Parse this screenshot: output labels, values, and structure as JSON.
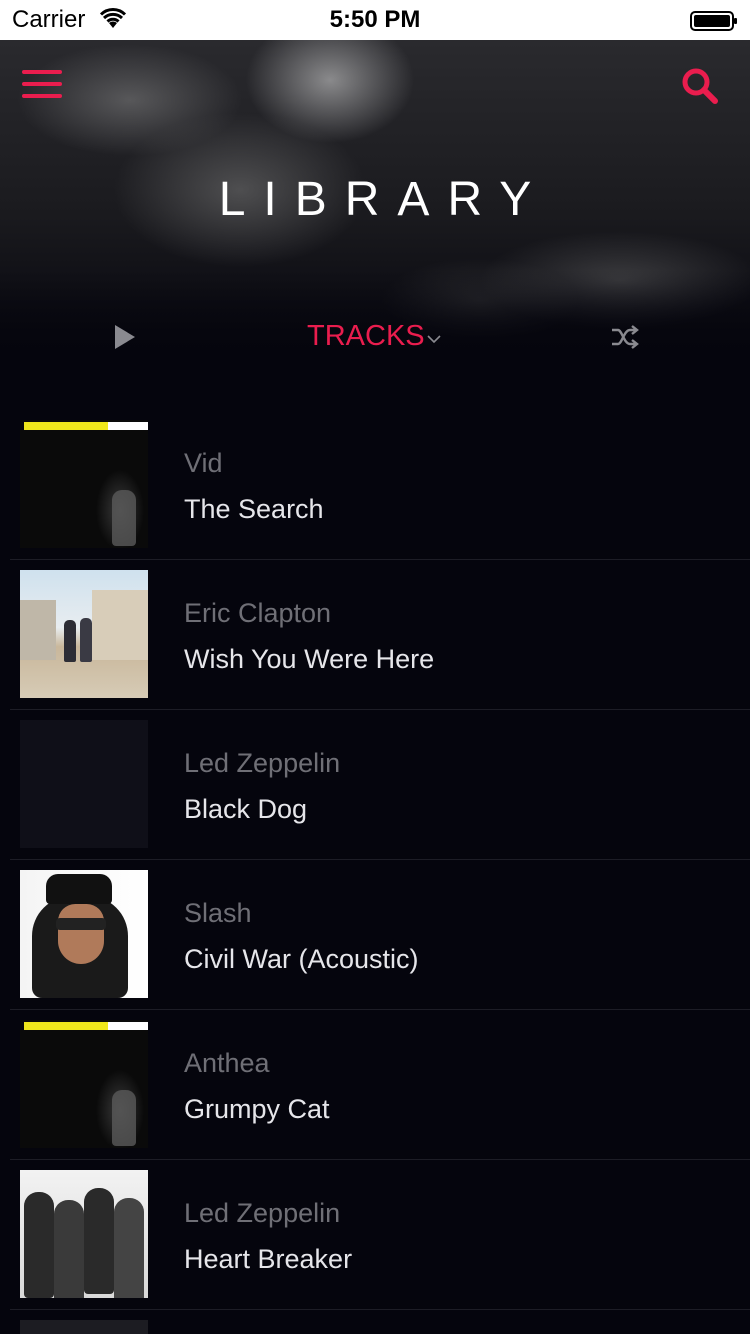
{
  "status_bar": {
    "carrier": "Carrier",
    "time": "5:50 PM"
  },
  "header": {
    "title": "LIBRARY",
    "selector_label": "TRACKS",
    "menu_icon": "hamburger-menu-icon",
    "search_icon": "search-icon",
    "play_icon": "play-icon",
    "shuffle_icon": "shuffle-icon"
  },
  "colors": {
    "accent": "#ea1d4e",
    "background": "#05050d",
    "artist_text": "#6f6f76",
    "title_text": "#e6e6ea"
  },
  "tracks": [
    {
      "artist": "Vid",
      "title": "The Search",
      "art": "dark-album-art"
    },
    {
      "artist": "Eric Clapton",
      "title": "Wish You Were Here",
      "art": "handshake-album-art"
    },
    {
      "artist": "Led Zeppelin",
      "title": "Black Dog",
      "art": "empty-album-art"
    },
    {
      "artist": "Slash",
      "title": "Civil War (Acoustic)",
      "art": "slash-portrait-art"
    },
    {
      "artist": "Anthea",
      "title": "Grumpy Cat",
      "art": "dark-album-art"
    },
    {
      "artist": "Led Zeppelin",
      "title": "Heart Breaker",
      "art": "band-photo-art"
    }
  ]
}
